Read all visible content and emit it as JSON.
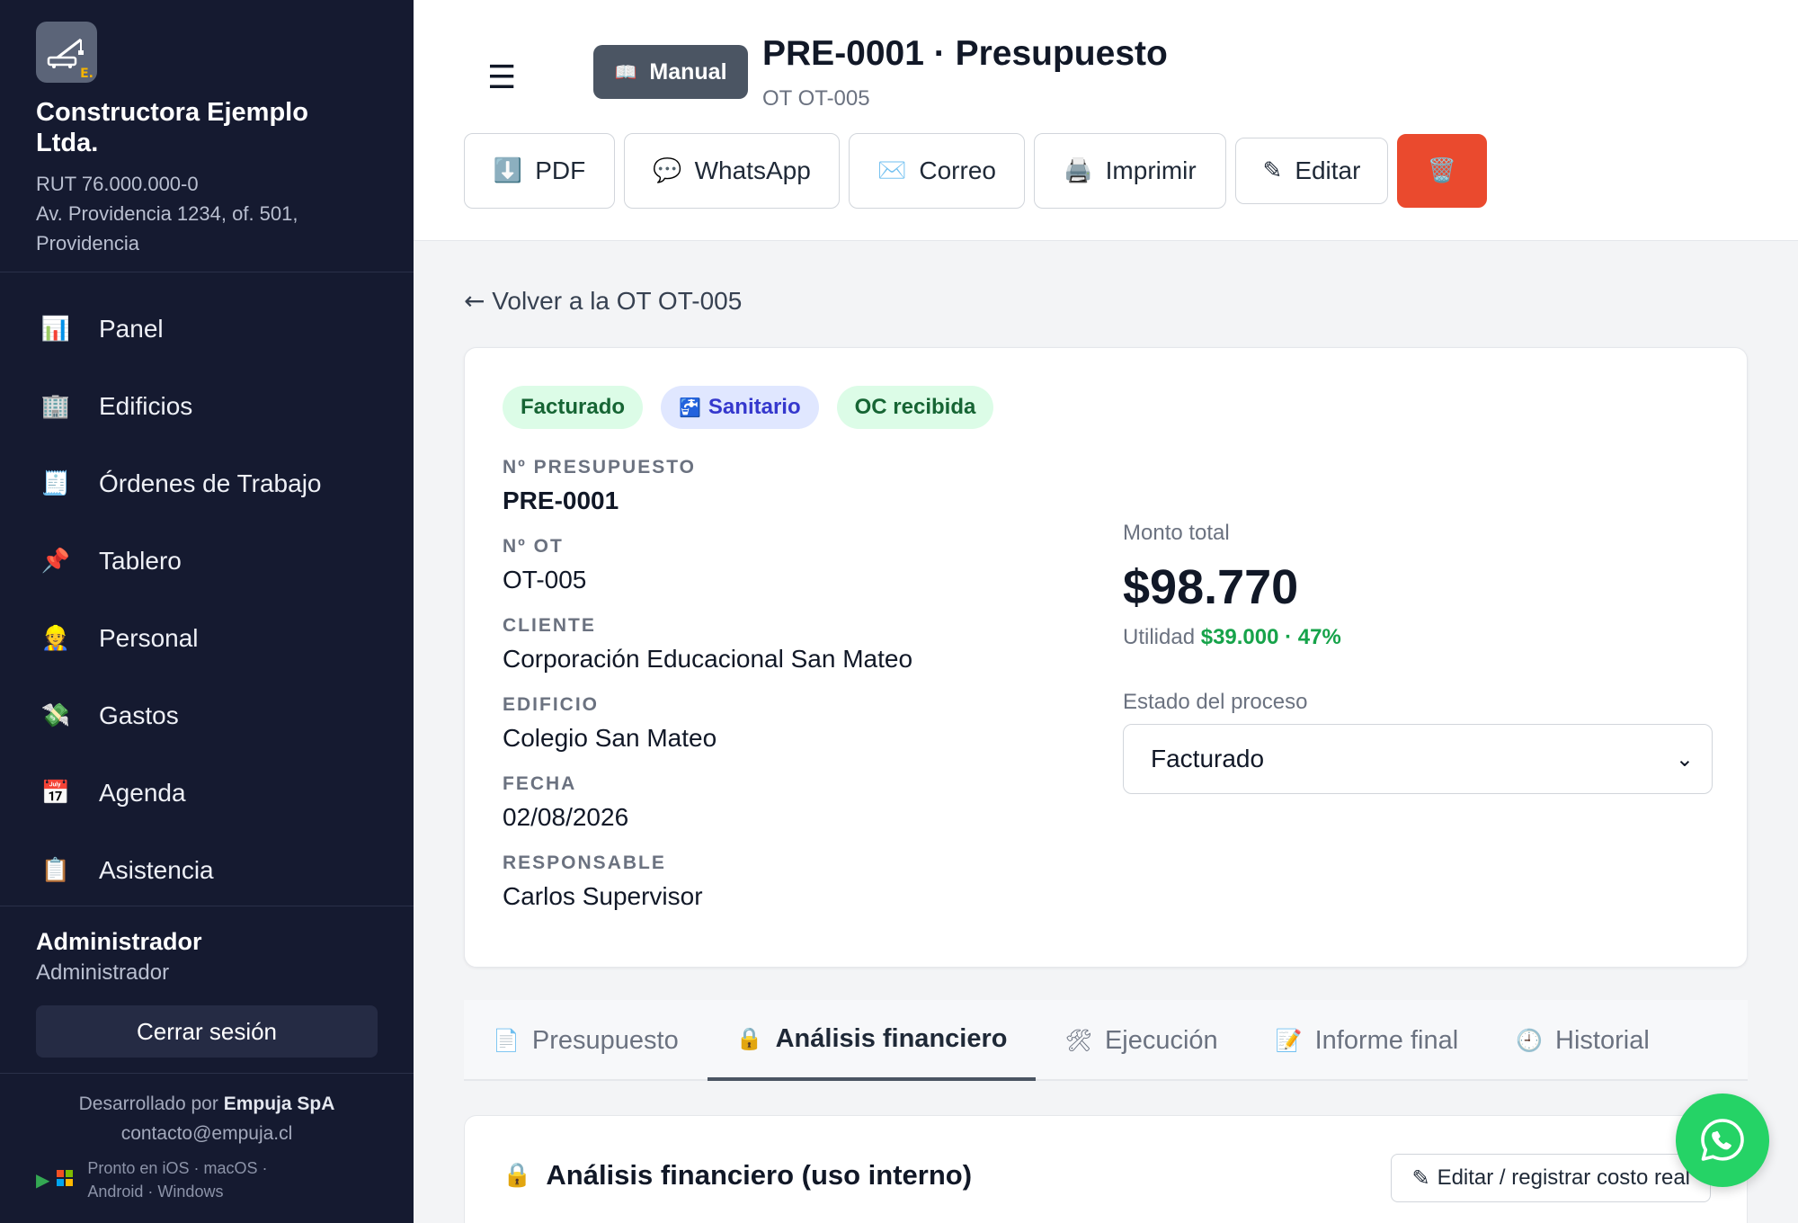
{
  "company": {
    "name": "Constructora Ejemplo Ltda.",
    "rut": "RUT 76.000.000-0",
    "address": "Av. Providencia 1234, of. 501, Providencia"
  },
  "nav": {
    "items": [
      {
        "label": "Panel",
        "icon": "📊"
      },
      {
        "label": "Edificios",
        "icon": "🏢"
      },
      {
        "label": "Órdenes de Trabajo",
        "icon": "🧾"
      },
      {
        "label": "Tablero",
        "icon": "📌"
      },
      {
        "label": "Personal",
        "icon": "👷"
      },
      {
        "label": "Gastos",
        "icon": "💸"
      },
      {
        "label": "Agenda",
        "icon": "📅"
      },
      {
        "label": "Asistencia",
        "icon": "📋"
      }
    ]
  },
  "user": {
    "name": "Administrador",
    "role": "Administrador",
    "logout_label": "Cerrar sesión"
  },
  "footer": {
    "developed_prefix": "Desarrollado por ",
    "developer": "Empuja SpA",
    "contact": "contacto@empuja.cl",
    "platforms_line1": "Pronto en iOS · macOS ·",
    "platforms_line2": "Android · Windows"
  },
  "header": {
    "manual_label": "Manual",
    "title": "PRE-0001 · Presupuesto",
    "subtitle": "OT OT-005"
  },
  "actions": {
    "pdf": "PDF",
    "whatsapp": "WhatsApp",
    "email": "Correo",
    "print": "Imprimir",
    "edit": "Editar"
  },
  "back_link": "Volver a la OT OT-005",
  "badges": {
    "status": "Facturado",
    "category": "Sanitario",
    "po": "OC recibida"
  },
  "fields": {
    "budget_no_label": "Nº PRESUPUESTO",
    "budget_no": "PRE-0001",
    "ot_no_label": "Nº OT",
    "ot_no": "OT-005",
    "client_label": "CLIENTE",
    "client": "Corporación Educacional San Mateo",
    "building_label": "EDIFICIO",
    "building": "Colegio San Mateo",
    "date_label": "FECHA",
    "date": "02/08/2026",
    "responsible_label": "RESPONSABLE",
    "responsible": "Carlos Supervisor"
  },
  "summary": {
    "total_label": "Monto total",
    "total": "$98.770",
    "utility_label": "Utilidad ",
    "utility_value": "$39.000 · 47%",
    "process_label": "Estado del proceso",
    "process_value": "Facturado"
  },
  "tabs": [
    {
      "label": "Presupuesto",
      "icon": "📄"
    },
    {
      "label": "Análisis financiero",
      "icon": "🔒"
    },
    {
      "label": "Ejecución",
      "icon": "🛠"
    },
    {
      "label": "Informe final",
      "icon": "📝"
    },
    {
      "label": "Historial",
      "icon": "🕘"
    }
  ],
  "financial": {
    "title": "Análisis financiero (uso interno)",
    "edit_button": "Editar / registrar costo real"
  },
  "colors": {
    "sidebar": "#151a30",
    "accent_green": "#16a34a",
    "danger": "#ea4a2e",
    "whatsapp": "#25d366"
  }
}
